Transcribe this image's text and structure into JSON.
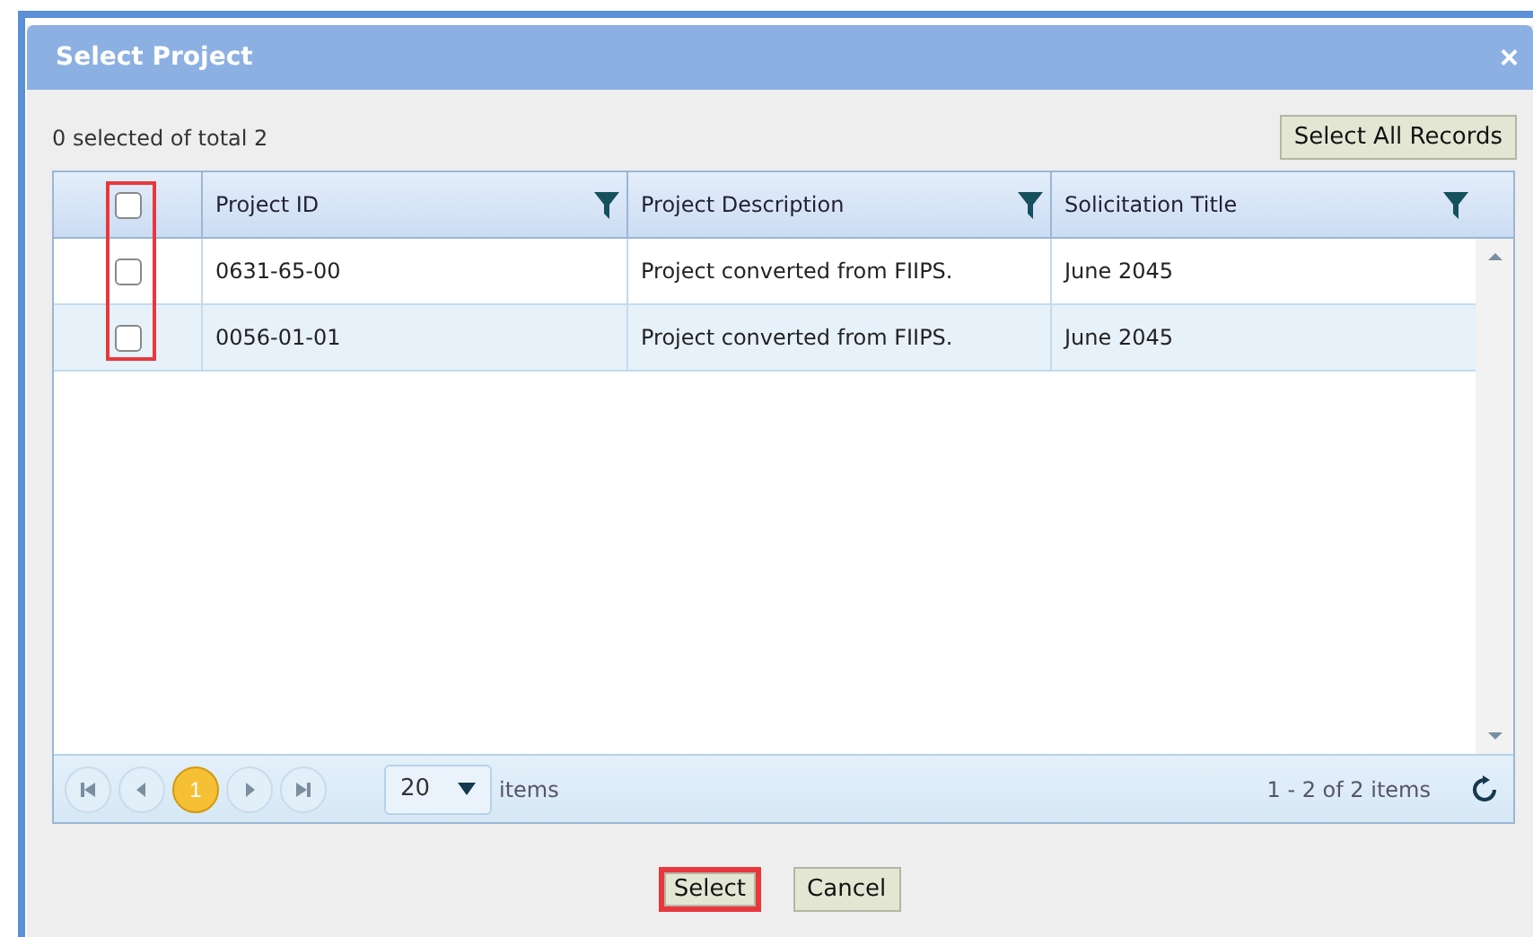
{
  "dialog": {
    "title": "Select Project",
    "close": "×"
  },
  "summary": "0 selected of total 2",
  "select_all_button": "Select All Records",
  "table": {
    "checkbox_column_highlighted": true,
    "header_checked": false,
    "columns": [
      "Project ID",
      "Project Description",
      "Solicitation Title"
    ],
    "rows": [
      {
        "checked": false,
        "cells": [
          "0631-65-00",
          "Project converted from FIIPS.",
          "June 2045"
        ]
      },
      {
        "checked": false,
        "cells": [
          "0056-01-01",
          "Project converted from FIIPS.",
          "June 2045"
        ]
      }
    ]
  },
  "pager": {
    "pages": [
      {
        "label": "1",
        "selected": true
      }
    ],
    "page_size": "20",
    "items_label": "items",
    "range": "1 - 2 of 2 items"
  },
  "buttons": [
    {
      "label": "Select",
      "highlighted": true
    },
    {
      "label": "Cancel",
      "highlighted": false
    }
  ]
}
